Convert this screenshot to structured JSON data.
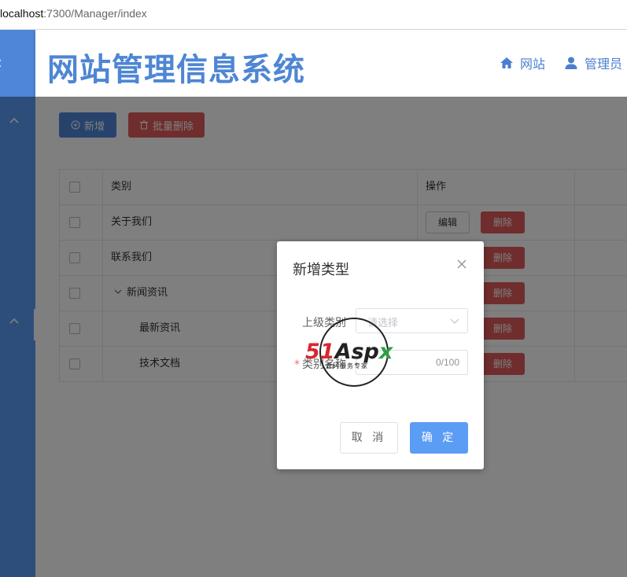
{
  "browser": {
    "url_host": "localhost",
    "url_rest": ":7300/Manager/index"
  },
  "header": {
    "title": "网站管理信息系统",
    "nav": [
      {
        "label": "网站",
        "icon": "home-icon"
      },
      {
        "label": "管理员",
        "icon": "user-icon"
      }
    ]
  },
  "toolbar": {
    "add_label": "新增",
    "batch_delete_label": "批量删除"
  },
  "table": {
    "columns": [
      "类别",
      "操作"
    ],
    "rows": [
      {
        "name": "关于我们",
        "level": 0,
        "expanded": false
      },
      {
        "name": "联系我们",
        "level": 0,
        "expanded": false
      },
      {
        "name": "新闻资讯",
        "level": 0,
        "expanded": true
      },
      {
        "name": "最新资讯",
        "level": 1,
        "expanded": false
      },
      {
        "name": "技术文档",
        "level": 1,
        "expanded": false
      }
    ],
    "edit_label": "编辑",
    "delete_label": "删除"
  },
  "dialog": {
    "title": "新增类型",
    "parent_label": "上级类别",
    "parent_placeholder": "请选择",
    "name_label": "类别名称",
    "name_count": "0/100",
    "cancel_label": "取 消",
    "ok_label": "确 定"
  },
  "watermark": {
    "red": "51",
    "dark": "Asp",
    "green": "x",
    "sub": "源码服务专家"
  },
  "colors": {
    "primary": "#5b9cf5",
    "danger": "#e15b5b",
    "brand": "#4e86d3"
  }
}
